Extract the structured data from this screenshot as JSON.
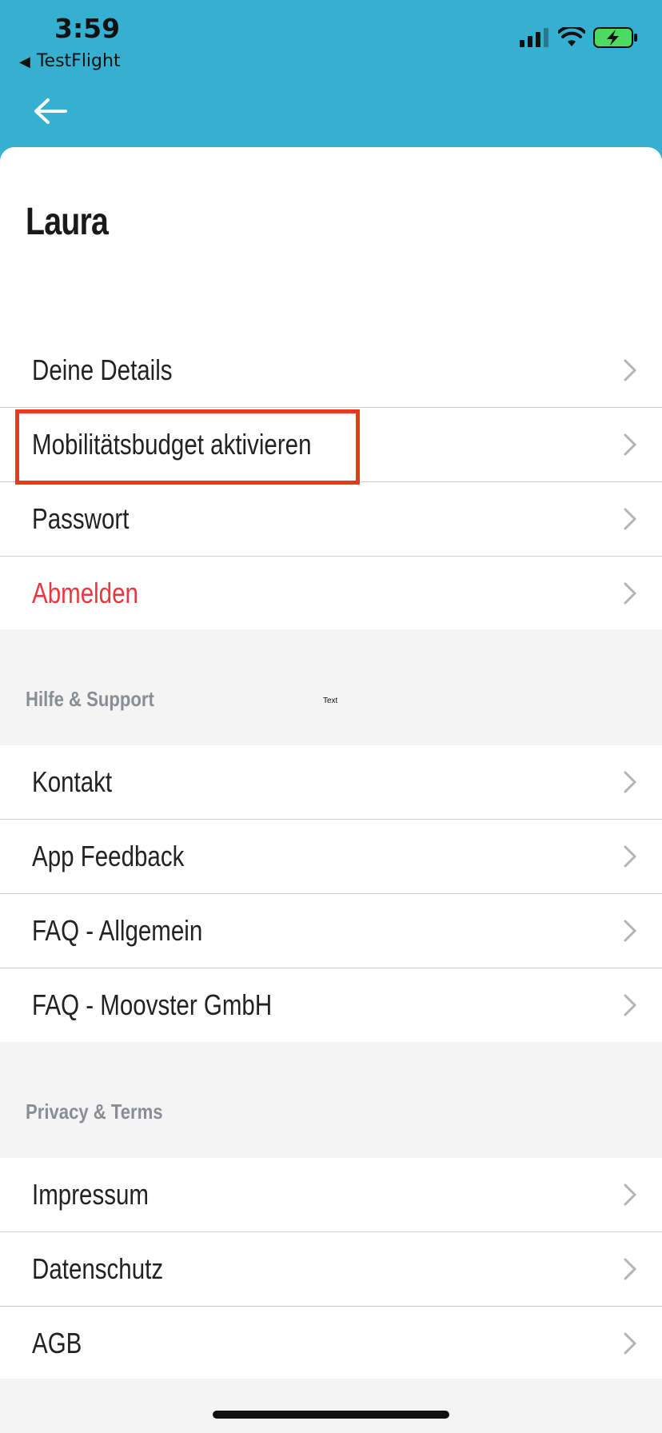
{
  "status_bar": {
    "time": "3:59",
    "back_app_label": "TestFlight",
    "icons": [
      "cellular-signal-icon",
      "wifi-icon",
      "battery-charging-icon"
    ]
  },
  "header": {
    "back_icon": "arrow-left-icon"
  },
  "profile": {
    "name": "Laura"
  },
  "account_items": [
    {
      "label": "Deine Details"
    },
    {
      "label": "Mobilitätsbudget aktivieren"
    },
    {
      "label": "Passwort"
    },
    {
      "label": "Abmelden"
    }
  ],
  "help_section": {
    "title": "Hilfe & Support",
    "stray_label": "Text",
    "items": [
      {
        "label": "Kontakt"
      },
      {
        "label": "App Feedback"
      },
      {
        "label": "FAQ - Allgemein"
      },
      {
        "label": "FAQ - Moovster GmbH"
      }
    ]
  },
  "privacy_section": {
    "title": "Privacy & Terms",
    "items": [
      {
        "label": "Impressum"
      },
      {
        "label": "Datenschutz"
      },
      {
        "label": "AGB"
      }
    ]
  },
  "colors": {
    "header": "#36b0d1",
    "danger": "#e8383f",
    "highlight": "#e8391f",
    "section_bg": "#f4f4f4"
  }
}
